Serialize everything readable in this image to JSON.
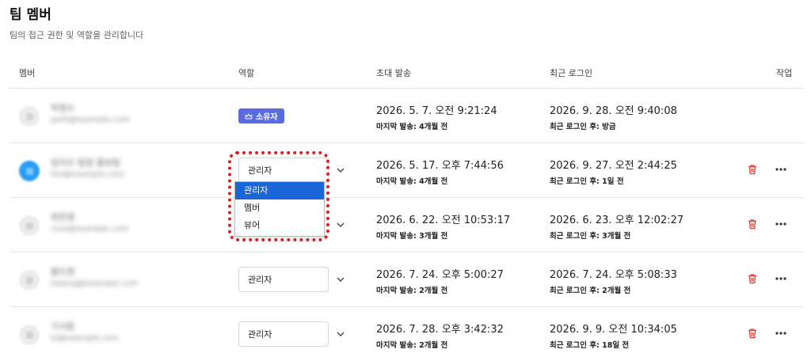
{
  "page": {
    "title": "팀 멤버",
    "subtitle": "팀의 접근 권한 및 역할을 관리합니다"
  },
  "columns": {
    "member": "멤버",
    "role": "역할",
    "invite_sent": "초대 발송",
    "last_login": "최근 로그인",
    "actions": "작업"
  },
  "rows": [
    {
      "name": "박정수",
      "email": "park@example.com",
      "role": "소유자",
      "role_type": "owner",
      "invite_date": "2026. 5. 7. 오전 9:21:24",
      "invite_sub": "마지막 발송: 4개월 전",
      "login_date": "2026. 9. 28. 오전 9:40:08",
      "login_sub": "최근 로그인 후: 방금"
    },
    {
      "name": "임지수 팀장 홍보팀",
      "email": "lim@example.com",
      "role": "관리자",
      "role_type": "select",
      "invite_date": "2026. 5. 17. 오후 7:44:56",
      "invite_sub": "마지막 발송: 4개월 전",
      "login_date": "2026. 9. 27. 오전 2:44:25",
      "login_sub": "최근 로그인 후: 1일 전"
    },
    {
      "name": "최은영",
      "email": "choi@example.com",
      "role": "관리자",
      "role_type": "select",
      "invite_date": "2026. 6. 22. 오전 10:53:17",
      "invite_sub": "마지막 발송: 3개월 전",
      "login_date": "2026. 6. 23. 오후 12:02:27",
      "login_sub": "최근 로그인 후: 3개월 전"
    },
    {
      "name": "황도현",
      "email": "hwang@example.com",
      "role": "관리자",
      "role_type": "select",
      "invite_date": "2026. 7. 24. 오후 5:00:27",
      "invite_sub": "마지막 발송: 2개월 전",
      "login_date": "2026. 7. 24. 오후 5:08:33",
      "login_sub": "최근 로그인 후: 2개월 전"
    },
    {
      "name": "기서윤",
      "email": "ki@example.com",
      "role": "관리자",
      "role_type": "select",
      "invite_date": "2026. 7. 28. 오후 3:42:32",
      "invite_sub": "마지막 발송: 2개월 전",
      "login_date": "2026. 9. 9. 오전 10:34:05",
      "login_sub": "최근 로그인 후: 18일 전"
    }
  ],
  "role_dropdown": {
    "options": [
      "관리자",
      "멤버",
      "뷰어"
    ],
    "selected": "관리자"
  },
  "colors": {
    "owner_badge": "#5b6ce0",
    "dropdown_selected": "#1a66d6",
    "trash": "#e53935",
    "highlight": "#e0191a"
  },
  "icons": {
    "owner": "crown-icon",
    "role_select": "chevron-down-icon",
    "delete": "trash-icon",
    "more": "more-horizontal-icon"
  }
}
